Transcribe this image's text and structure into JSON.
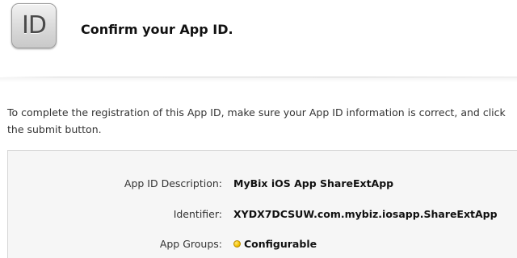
{
  "header": {
    "icon_text": "ID",
    "title": "Confirm your App ID."
  },
  "intro_text": "To complete the registration of this App ID, make sure your App ID information is correct, and click the submit button.",
  "details": {
    "description": {
      "label": "App ID Description:",
      "value": "MyBix iOS App ShareExtApp"
    },
    "identifier": {
      "label": "Identifier:",
      "value": "XYDX7DCSUW.com.mybiz.iosapp.ShareExtApp"
    },
    "app_groups": {
      "label": "App Groups:",
      "value": "Configurable",
      "status_color": "#f5c400"
    }
  }
}
